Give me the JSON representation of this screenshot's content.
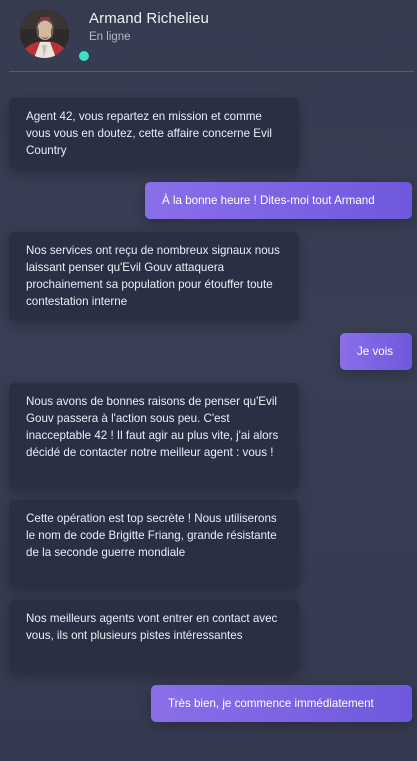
{
  "contact": {
    "name": "Armand Richelieu",
    "status": "En ligne"
  },
  "messages": [
    {
      "direction": "in",
      "text": "Agent 42, vous repartez en mission et comme vous vous en doutez, cette affaire concerne Evil Country"
    },
    {
      "direction": "out",
      "text": "À la bonne heure ! Dites-moi tout Armand"
    },
    {
      "direction": "in",
      "text": "Nos services ont reçu de nombreux signaux nous laissant penser qu'Evil Gouv attaquera prochainement sa population pour étouffer toute contestation interne"
    },
    {
      "direction": "out",
      "text": "Je vois"
    },
    {
      "direction": "in",
      "text": "Nous avons de bonnes raisons de penser qu'Evil Gouv passera à l'action sous peu. C'est inacceptable 42 ! Il faut agir au plus vite, j'ai alors décidé de contacter notre meilleur agent : vous !"
    },
    {
      "direction": "in",
      "text": "Cette opération est top secrète ! Nous utiliserons le nom de code Brigitte Friang, grande résistante de la seconde guerre mondiale"
    },
    {
      "direction": "in",
      "text": "Nos meilleurs agents vont entrer en contact avec vous, ils ont plusieurs pistes intéressantes"
    },
    {
      "direction": "out",
      "text": "Très bien, je commence immédiatement"
    }
  ],
  "colors": {
    "background": "#383d53",
    "incoming_bubble": "#2b2f44",
    "outgoing_bubble_start": "#8a6fe8",
    "outgoing_bubble_end": "#6f58de",
    "online_dot": "#3fe0c8"
  },
  "icons": {
    "avatar": "portrait-avatar",
    "status": "online-status-dot"
  }
}
